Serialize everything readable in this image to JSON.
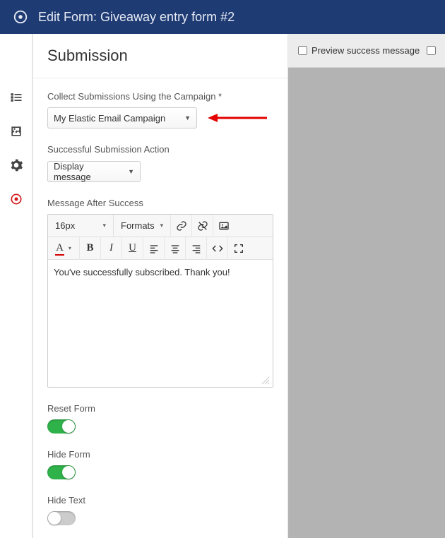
{
  "header": {
    "title": "Edit Form: Giveaway entry form #2"
  },
  "panel": {
    "title": "Submission",
    "campaign_label": "Collect Submissions Using the Campaign *",
    "campaign_value": "My Elastic Email Campaign",
    "action_label": "Successful Submission Action",
    "action_value": "Display message",
    "message_label": "Message After Success",
    "editor": {
      "font_size": "16px",
      "formats_label": "Formats",
      "content": "You've successfully subscribed. Thank you!"
    },
    "reset_form_label": "Reset Form",
    "reset_form_on": true,
    "hide_form_label": "Hide Form",
    "hide_form_on": true,
    "hide_text_label": "Hide Text",
    "hide_text_on": false
  },
  "preview": {
    "preview_success_label": "Preview success message"
  }
}
